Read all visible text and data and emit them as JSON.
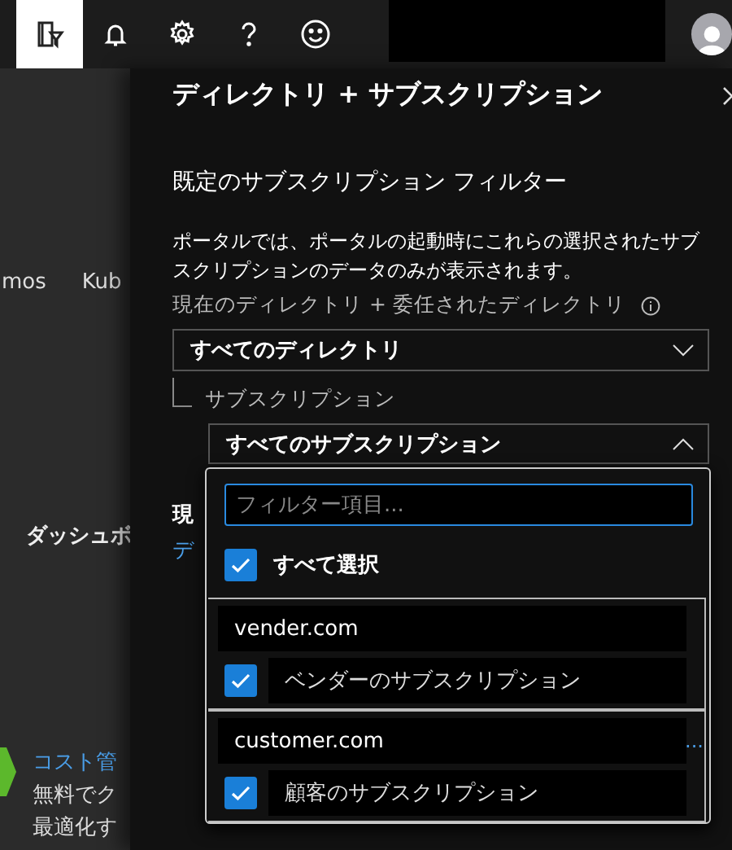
{
  "top_bar": {
    "icons": [
      {
        "kind": "filter",
        "selected": true
      },
      {
        "kind": "bell",
        "selected": false
      },
      {
        "kind": "gear",
        "selected": false
      },
      {
        "kind": "help",
        "selected": false
      },
      {
        "kind": "smiley",
        "selected": false
      }
    ]
  },
  "background": {
    "tabs": [
      "mos",
      "Kub"
    ],
    "dashboard": "ダッシュボ",
    "cost_title": "コスト管",
    "cost_lines": [
      "無料でク",
      "最適化す"
    ]
  },
  "panel": {
    "title": "ディレクトリ + サブスクリプション",
    "heading": "既定のサブスクリプション フィルター",
    "description": "ポータルでは、ポータルの起動時にこれらの選択されたサブスクリプションのデータのみが表示されます。",
    "directory_label": "現在のディレクトリ + 委任されたディレクトリ",
    "directory_value": "すべてのディレクトリ",
    "subscription_label": "サブスクリプション",
    "subscription_value": "すべてのサブスクリプション",
    "subscription_expanded": true,
    "hidden_label": "現",
    "hidden_link": "デ",
    "hidden_more": "..."
  },
  "popup": {
    "placeholder": "フィルター項目...",
    "select_all": {
      "label": "すべて選択",
      "checked": true
    },
    "groups": [
      {
        "directory": "vender.com",
        "items": [
          {
            "label": "ベンダーのサブスクリプション",
            "checked": true
          }
        ]
      },
      {
        "directory": "customer.com",
        "items": [
          {
            "label": "顧客のサブスクリプション",
            "checked": true
          }
        ]
      }
    ]
  }
}
